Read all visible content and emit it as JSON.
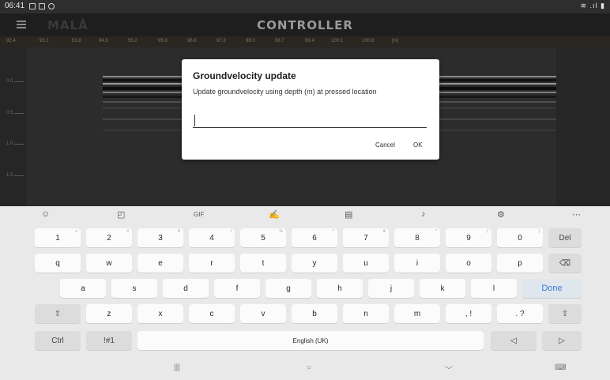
{
  "status_bar": {
    "time": "06:41",
    "right_icons": "≋ .ıl ▮"
  },
  "app_bar": {
    "logo": "MALÅ",
    "title": "CONTROLLER"
  },
  "ruler": {
    "labels": [
      "92.4",
      "93.1",
      "93.8",
      "94.5",
      "95.2",
      "95.9",
      "96.6",
      "97.3",
      "98.0",
      "98.7",
      "99.4",
      "100.1",
      "100.8",
      "[m]"
    ]
  },
  "depth_axis": {
    "labels": [
      "0.0",
      "0.5",
      "1.0",
      "1.5"
    ]
  },
  "dialog": {
    "title": "Groundvelocity update",
    "message": "Update groundvelocity using depth (m) at pressed location",
    "input_value": "",
    "cancel_label": "Cancel",
    "ok_label": "OK"
  },
  "keyboard": {
    "toolbar_icons": [
      "emoji-icon",
      "sticker-icon",
      "gif-icon",
      "handwriting-icon",
      "clipboard-icon",
      "mic-icon",
      "settings-icon",
      "more-icon"
    ],
    "row1": [
      {
        "label": "1",
        "sup": "+"
      },
      {
        "label": "2",
        "sup": "#"
      },
      {
        "label": "3",
        "sup": "¥"
      },
      {
        "label": "4",
        "sup": "/"
      },
      {
        "label": "5",
        "sup": "%"
      },
      {
        "label": "6",
        "sup": "^"
      },
      {
        "label": "7",
        "sup": "&"
      },
      {
        "label": "8",
        "sup": "*"
      },
      {
        "label": "9",
        "sup": "("
      },
      {
        "label": "0",
        "sup": ")"
      },
      {
        "label": "Del",
        "sup": ""
      }
    ],
    "row2": [
      "q",
      "w",
      "e",
      "r",
      "t",
      "y",
      "u",
      "i",
      "o",
      "p",
      "⌫"
    ],
    "row3": [
      "a",
      "s",
      "d",
      "f",
      "g",
      "h",
      "j",
      "k",
      "l",
      "Done"
    ],
    "row4": [
      "⇧",
      "z",
      "x",
      "c",
      "v",
      "b",
      "n",
      "m",
      ", !",
      ". ?",
      "⇧"
    ],
    "row5": {
      "ctrl": "Ctrl",
      "symbols": "!#1",
      "space": "English (UK)",
      "left": "◁",
      "right": "▷"
    }
  },
  "nav_bar": {
    "recents": "|||",
    "home": "○",
    "back": "﹀",
    "keyboard": "⌨"
  }
}
